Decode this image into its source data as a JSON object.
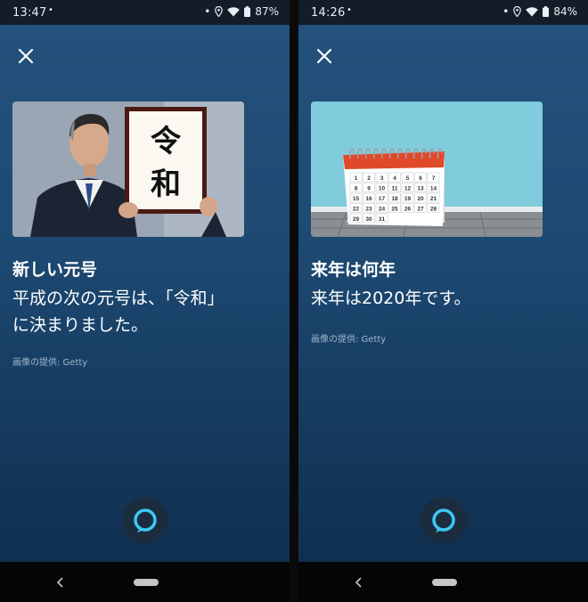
{
  "screens": [
    {
      "status": {
        "time": "13:47",
        "notification_dot": "•",
        "battery_percent": "87%"
      },
      "card": {
        "image_subject": "person holding calligraphy sign",
        "sign_text": "令和",
        "title": "新しい元号",
        "body_line1": "平成の次の元号は、「令和」",
        "body_line2": "に決まりました。",
        "attribution": "画像の提供: Getty"
      }
    },
    {
      "status": {
        "time": "14:26",
        "notification_dot": "•",
        "battery_percent": "84%"
      },
      "card": {
        "image_subject": "desk calendar",
        "title": "来年は何年",
        "body_line1": "来年は2020年です。",
        "body_line2": "",
        "attribution": "画像の提供: Getty"
      }
    }
  ],
  "calendar_days": [
    "1",
    "2",
    "3",
    "4",
    "5",
    "6",
    "7",
    "8",
    "9",
    "10",
    "11",
    "12",
    "13",
    "14",
    "15",
    "16",
    "17",
    "18",
    "19",
    "20",
    "21",
    "22",
    "23",
    "24",
    "25",
    "26",
    "27",
    "28",
    "29",
    "30",
    "31"
  ],
  "icons": {
    "status_dot": "dot-icon",
    "location": "location-icon",
    "wifi": "wifi-icon",
    "battery": "battery-icon",
    "close": "close-icon",
    "alexa": "alexa-ring-icon",
    "back": "back-icon",
    "home": "home-pill-icon"
  },
  "colors": {
    "background_top": "#24527c",
    "background_bottom": "#0f2f4f",
    "alexa_ring": "#3ec8f2",
    "calendar_red": "#e04a2a",
    "wall_teal": "#74c4d6"
  }
}
